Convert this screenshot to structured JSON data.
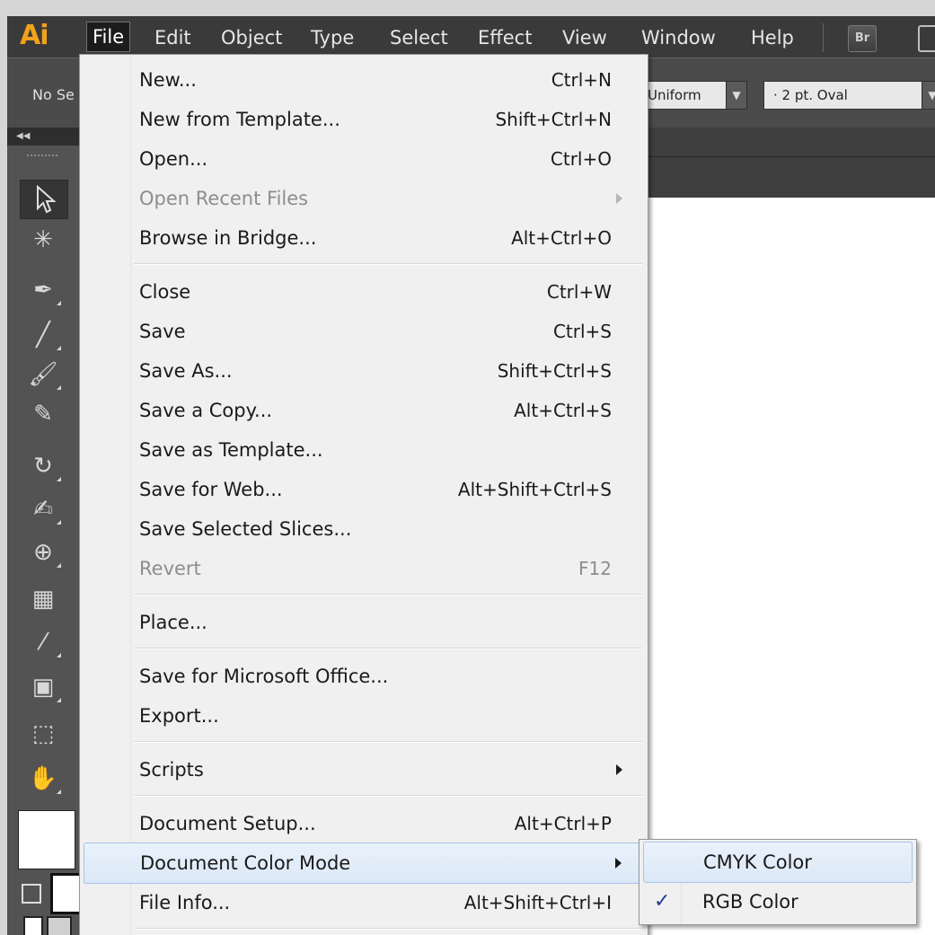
{
  "app": {
    "logo": "Ai"
  },
  "menubar": {
    "items": [
      {
        "label": "File",
        "active": true
      },
      {
        "label": "Edit"
      },
      {
        "label": "Object"
      },
      {
        "label": "Type"
      },
      {
        "label": "Select"
      },
      {
        "label": "Effect"
      },
      {
        "label": "View"
      },
      {
        "label": "Window"
      },
      {
        "label": "Help"
      }
    ],
    "bridge_button": "Br"
  },
  "controlbar": {
    "selection_label": "No Se",
    "stroke_profile": "Uniform",
    "brush": "· 2 pt. Oval"
  },
  "file_menu": {
    "items": [
      {
        "label": "New...",
        "shortcut": "Ctrl+N"
      },
      {
        "label": "New from Template...",
        "shortcut": "Shift+Ctrl+N"
      },
      {
        "label": "Open...",
        "shortcut": "Ctrl+O"
      },
      {
        "label": "Open Recent Files",
        "disabled": true,
        "submenu": true
      },
      {
        "label": "Browse in Bridge...",
        "shortcut": "Alt+Ctrl+O"
      },
      {
        "label": "Close",
        "shortcut": "Ctrl+W"
      },
      {
        "label": "Save",
        "shortcut": "Ctrl+S"
      },
      {
        "label": "Save As...",
        "shortcut": "Shift+Ctrl+S"
      },
      {
        "label": "Save a Copy...",
        "shortcut": "Alt+Ctrl+S"
      },
      {
        "label": "Save as Template..."
      },
      {
        "label": "Save for Web...",
        "shortcut": "Alt+Shift+Ctrl+S"
      },
      {
        "label": "Save Selected Slices..."
      },
      {
        "label": "Revert",
        "shortcut": "F12",
        "disabled": true
      },
      {
        "label": "Place..."
      },
      {
        "label": "Save for Microsoft Office..."
      },
      {
        "label": "Export..."
      },
      {
        "label": "Scripts",
        "submenu": true
      },
      {
        "label": "Document Setup...",
        "shortcut": "Alt+Ctrl+P"
      },
      {
        "label": "Document Color Mode",
        "submenu": true,
        "highlighted": true
      },
      {
        "label": "File Info...",
        "shortcut": "Alt+Shift+Ctrl+I"
      }
    ]
  },
  "color_mode_submenu": {
    "items": [
      {
        "label": "CMYK Color",
        "checked": false,
        "highlighted": true
      },
      {
        "label": "RGB Color",
        "checked": true
      }
    ],
    "check_glyph": "✓"
  },
  "colors": {
    "logo": "#f2a21a",
    "menubar_bg": "#3a3a3a",
    "menu_bg": "#f0f0f0",
    "highlight_border": "#a7c3e6",
    "disabled_text": "#8d8d8d"
  }
}
